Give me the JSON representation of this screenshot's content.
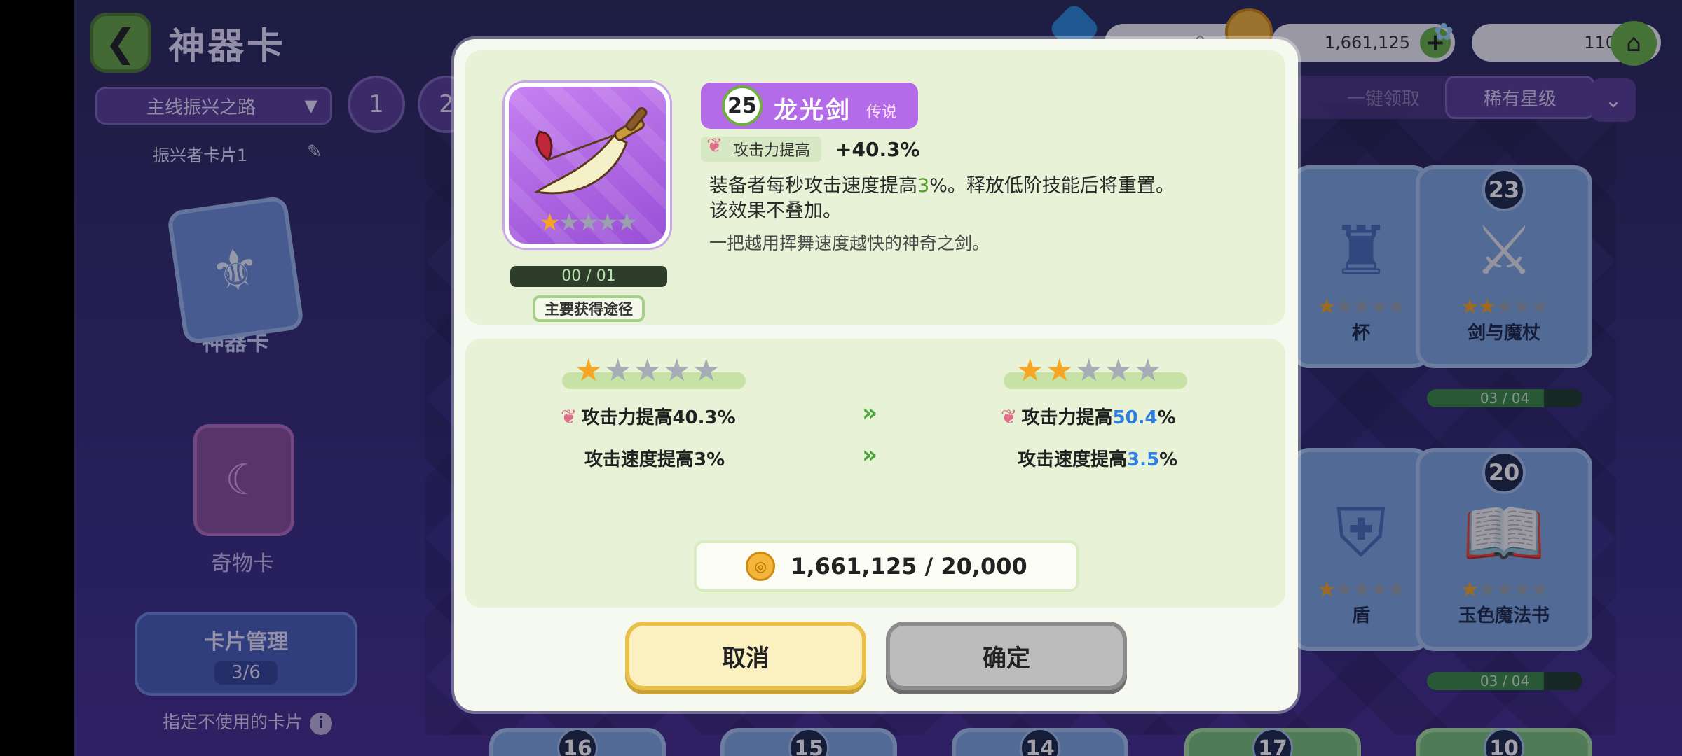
{
  "header": {
    "title": "神器卡",
    "back_icon": "back-arrow-icon"
  },
  "resources": {
    "gems": "0",
    "gold": "1,661,125",
    "fairy": "110"
  },
  "toolbar": {
    "route": "主线振兴之路",
    "pages": [
      "1",
      "2"
    ],
    "deck_name": "振兴者卡片1",
    "claim_all": "一键领取",
    "sort": "稀有星级"
  },
  "sidebar": {
    "artifact_tab": "神器卡",
    "curio_tab": "奇物卡",
    "card_mgmt_title": "卡片管理",
    "card_mgmt_count": "3/6",
    "unused_label": "指定不使用的卡片"
  },
  "bg_cards": [
    {
      "level": "23",
      "name": "剑与魔杖",
      "progress": "03 / 04",
      "stars": 2
    },
    {
      "level": "20",
      "name": "玉色魔法书",
      "progress": "03 / 04",
      "stars": 1
    },
    {
      "name": "杯",
      "stars": 1
    },
    {
      "name": "盾",
      "stars": 1
    }
  ],
  "bottom_levels": [
    "16",
    "15",
    "14",
    "17",
    "10"
  ],
  "modal": {
    "level": "25",
    "name": "龙光剑",
    "rarity": "传说",
    "stat_label": "攻击力提高",
    "stat_value": "+40.3%",
    "desc_a": "装备者每秒攻击速度提高",
    "desc_hl": "3",
    "desc_b": "%。释放低阶技能后将重置。",
    "desc_c": "该效果不叠加。",
    "flavor": "一把越用挥舞速度越快的神奇之剑。",
    "progress": "00 / 01",
    "source_btn": "主要获得途径",
    "current": {
      "stars": 1,
      "atk": "攻击力提高40.3%",
      "spd": "攻击速度提高3%"
    },
    "next": {
      "stars": 2,
      "atk_prefix": "攻击力提高",
      "atk_value": "50.4",
      "atk_suffix": "%",
      "spd_prefix": "攻击速度提高",
      "spd_value": "3.5",
      "spd_suffix": "%"
    },
    "cost": "1,661,125 / 20,000",
    "cancel": "取消",
    "confirm": "确定"
  },
  "colors": {
    "legend_purple": "#b36be8",
    "accent_green": "#6ab446",
    "highlight_blue": "#2d7fe3",
    "star_gold": "#f6a623"
  }
}
